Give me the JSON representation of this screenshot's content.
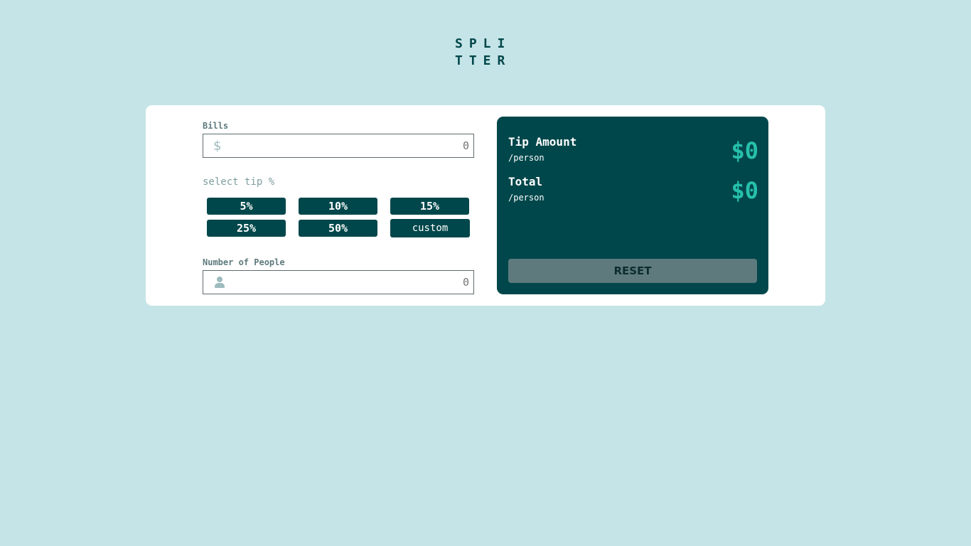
{
  "logo": {
    "line1": "SPLI",
    "line2": "TTER"
  },
  "bill": {
    "label": "Bills",
    "placeholder": "0",
    "currency_icon": "dollar-icon"
  },
  "tip": {
    "label": "select tip %",
    "options": [
      "5%",
      "10%",
      "15%",
      "25%",
      "50%"
    ],
    "custom_label": "custom"
  },
  "people": {
    "label": "Number of People",
    "placeholder": "0",
    "icon": "person-icon"
  },
  "results": {
    "tip_title": "Tip Amount",
    "tip_sub": "/person",
    "tip_value": "$0",
    "total_title": "Total",
    "total_sub": "/person",
    "total_value": "$0",
    "reset_label": "RESET"
  },
  "colors": {
    "background": "#c5e4e7",
    "primary": "#00474b",
    "accent": "#26c0ab",
    "muted": "#5e7a7d"
  }
}
